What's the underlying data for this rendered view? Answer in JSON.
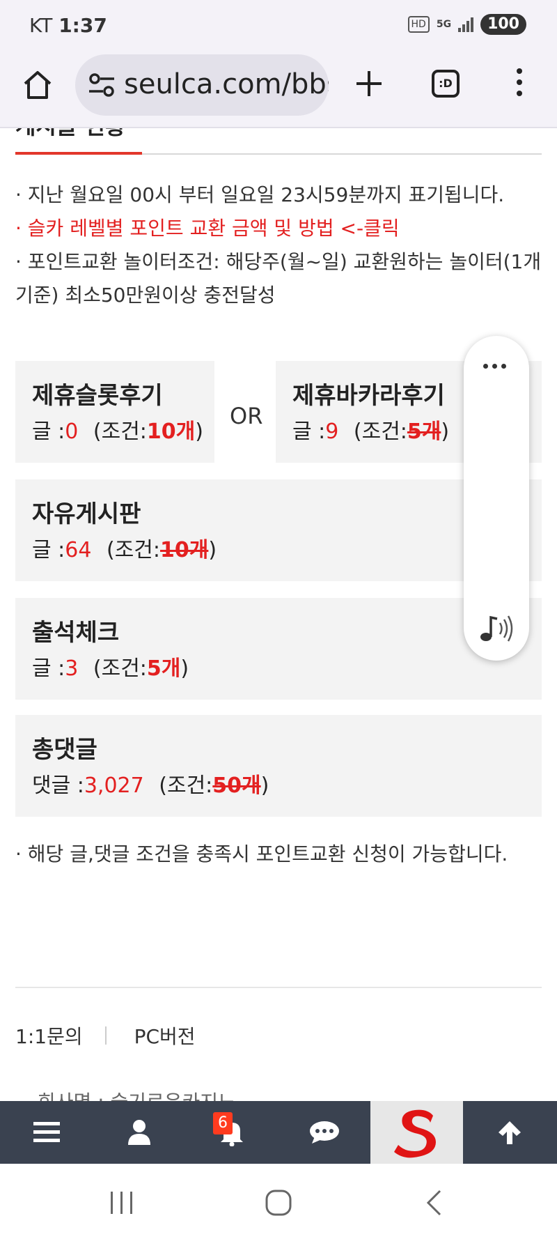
{
  "status_bar": {
    "carrier": "KT",
    "time": "1:37",
    "hd_icon": "HD",
    "network": "5G",
    "battery": "100"
  },
  "browser": {
    "url": "seulca.com/bbs",
    "tabs_icon_label": ":D",
    "icons": [
      "home-icon",
      "site-settings-icon",
      "new-tab-plus-icon",
      "tabs-icon",
      "more-menu-icon"
    ]
  },
  "section": {
    "title": "게시글 현황"
  },
  "notes": {
    "line1": "· 지난 월요일 00시 부터 일요일 23시59분까지 표기됩니다.",
    "line2_link": "· 슬카 레벨별 포인트 교환 금액 및 방법 <-클릭",
    "line3": "· 포인트교환 놀이터조건: 해당주(월~일) 교환원하는 놀이터(1개기준) 최소50만원이상 충전달성"
  },
  "cards": {
    "or_label": "OR",
    "slot_review": {
      "title": "제휴슬롯후기",
      "count_label": "글 :",
      "count": "0",
      "cond_open": "(조건:",
      "cond_value": "10개",
      "cond_close": ")",
      "met": false
    },
    "baccarat_review": {
      "title": "제휴바카라후기",
      "count_label": "글 :",
      "count": "9",
      "cond_open": "(조건:",
      "cond_value": "5개",
      "cond_close": ")",
      "met": true
    },
    "free_board": {
      "title": "자유게시판",
      "count_label": "글 :",
      "count": "64",
      "cond_open": "(조건:",
      "cond_value": "10개",
      "cond_close": ")",
      "met": true
    },
    "attendance": {
      "title": "출석체크",
      "count_label": "글 :",
      "count": "3",
      "cond_open": "(조건:",
      "cond_value": "5개",
      "cond_close": ")",
      "met": false
    },
    "total_comments": {
      "title": "총댓글",
      "count_label": "댓글 :",
      "count": "3,027",
      "cond_open": "(조건:",
      "cond_value": "50개",
      "cond_close": ")",
      "met": true
    }
  },
  "bottom_note": "· 해당 글,댓글 조건을 충족시 포인트교환 신청이 가능합니다.",
  "footer": {
    "inquiry": "1:1문의",
    "pc_version": "PC버전",
    "company_partial": "회사명 : 슬기로운카지노"
  },
  "site_nav": {
    "notification_count": "6",
    "items": [
      "menu-icon",
      "user-icon",
      "bell-icon",
      "chat-icon",
      "site-logo",
      "arrow-up-icon"
    ]
  },
  "colors": {
    "accent_red": "#e32020",
    "nav_bg": "#3a4250",
    "card_bg": "#f3f3f3",
    "badge": "#ff3b1f"
  }
}
